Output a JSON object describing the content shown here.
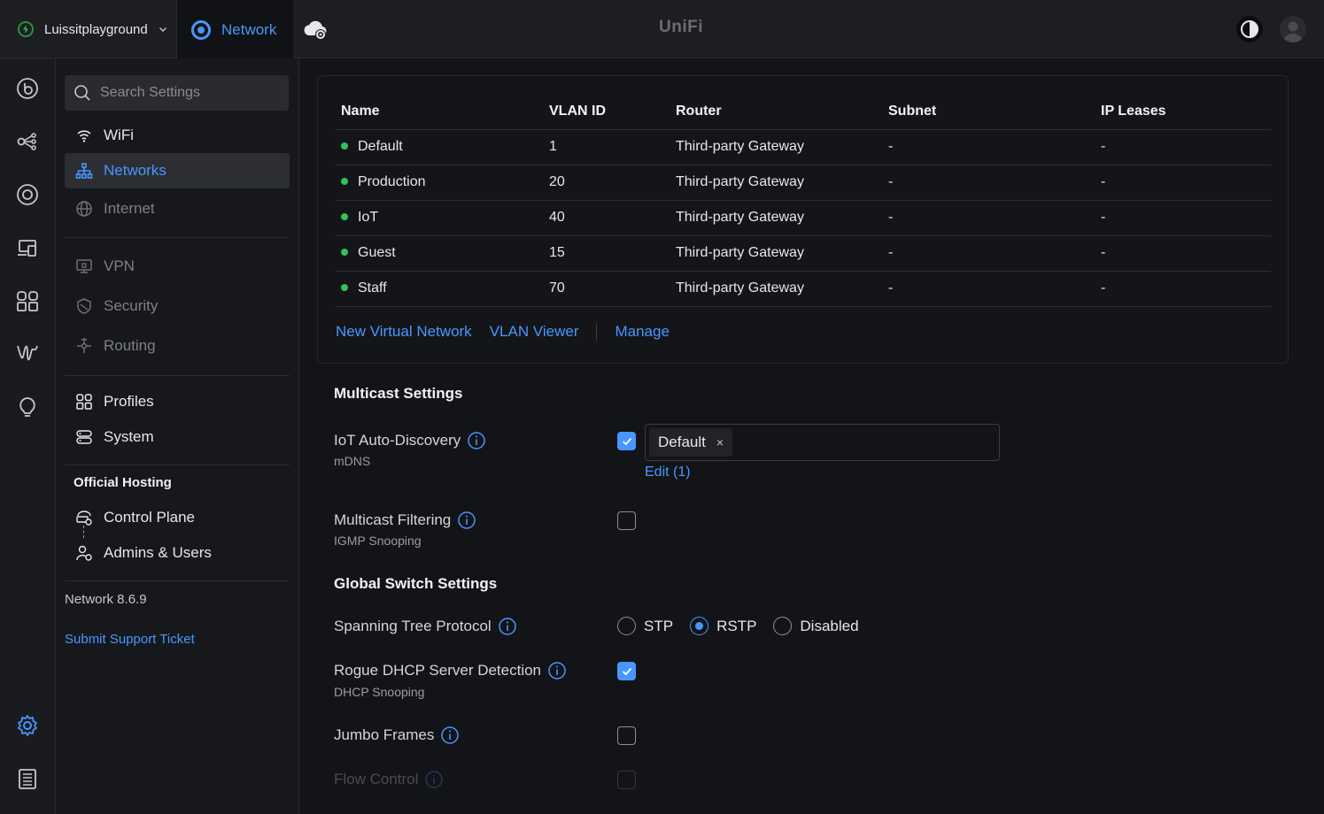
{
  "header": {
    "site_name": "Luissitplayground",
    "app_tab": "Network",
    "brand": "UniFi"
  },
  "sidebar": {
    "search_placeholder": "Search Settings",
    "items": {
      "wifi": "WiFi",
      "networks": "Networks",
      "internet": "Internet",
      "vpn": "VPN",
      "security": "Security",
      "routing": "Routing",
      "profiles": "Profiles",
      "system": "System",
      "control_plane": "Control Plane",
      "admins": "Admins & Users"
    },
    "hosting_title": "Official Hosting",
    "version": "Network 8.6.9",
    "support": "Submit Support Ticket"
  },
  "networks_table": {
    "columns": [
      "Name",
      "VLAN ID",
      "Router",
      "Subnet",
      "IP Leases"
    ],
    "rows": [
      {
        "name": "Default",
        "vlan": "1",
        "router": "Third-party Gateway",
        "subnet": "-",
        "leases": "-"
      },
      {
        "name": "Production",
        "vlan": "20",
        "router": "Third-party Gateway",
        "subnet": "-",
        "leases": "-"
      },
      {
        "name": "IoT",
        "vlan": "40",
        "router": "Third-party Gateway",
        "subnet": "-",
        "leases": "-"
      },
      {
        "name": "Guest",
        "vlan": "15",
        "router": "Third-party Gateway",
        "subnet": "-",
        "leases": "-"
      },
      {
        "name": "Staff",
        "vlan": "70",
        "router": "Third-party Gateway",
        "subnet": "-",
        "leases": "-"
      }
    ],
    "links": {
      "new_network": "New Virtual Network",
      "vlan_viewer": "VLAN Viewer",
      "manage": "Manage"
    }
  },
  "multicast": {
    "title": "Multicast Settings",
    "iot_label": "IoT Auto-Discovery",
    "iot_sub": "mDNS",
    "iot_checked": true,
    "iot_tag": "Default",
    "iot_tag_remove": "×",
    "edit_link": "Edit (1)",
    "filter_label": "Multicast Filtering",
    "filter_sub": "IGMP Snooping",
    "filter_checked": false
  },
  "global_switch": {
    "title": "Global Switch Settings",
    "stp_label": "Spanning Tree Protocol",
    "stp_options": [
      "STP",
      "RSTP",
      "Disabled"
    ],
    "stp_selected": "RSTP",
    "rogue_label": "Rogue DHCP Server Detection",
    "rogue_sub": "DHCP Snooping",
    "rogue_checked": true,
    "jumbo_label": "Jumbo Frames",
    "jumbo_checked": false,
    "flow_label": "Flow Control",
    "flow_checked": false
  },
  "colors": {
    "accent": "#4797ff",
    "status_online": "#33c05a",
    "background": "#131417",
    "sidebar": "#17181c"
  }
}
